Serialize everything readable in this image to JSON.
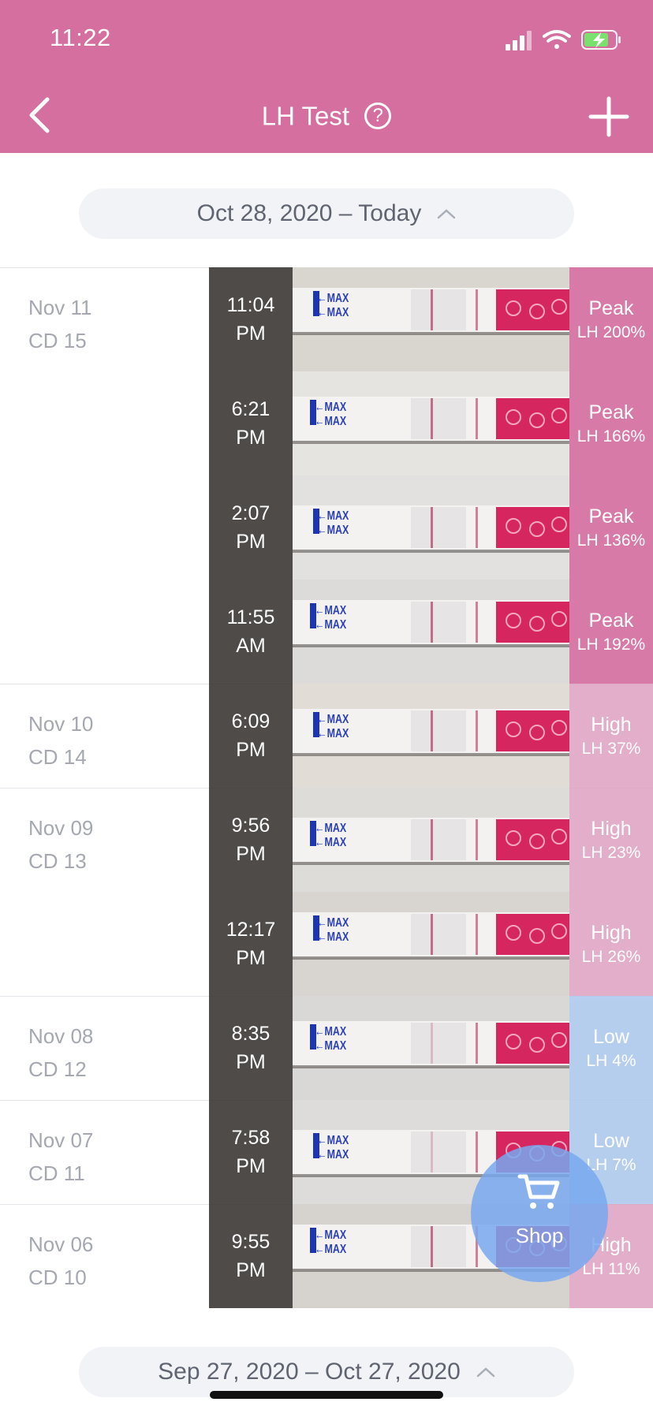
{
  "status_bar": {
    "time": "11:22"
  },
  "nav": {
    "title": "LH Test",
    "help_glyph": "?"
  },
  "ranges": {
    "current": "Oct 28, 2020 – Today",
    "previous": "Sep 27, 2020 – Oct 27, 2020"
  },
  "colors": {
    "header": "#D46FA0",
    "peak": "#D46FA0",
    "high": "#DDA0C0",
    "low": "#A9C6EC",
    "fab": "#78A8EE"
  },
  "entries": [
    {
      "date": "Nov 11",
      "cycle_day": "CD 15",
      "time": "11:04",
      "ampm": "PM",
      "level": "Peak",
      "lh": "LH 200%",
      "tone": "peak"
    },
    {
      "date": "",
      "cycle_day": "",
      "time": "6:21",
      "ampm": "PM",
      "level": "Peak",
      "lh": "LH 166%",
      "tone": "peak"
    },
    {
      "date": "",
      "cycle_day": "",
      "time": "2:07",
      "ampm": "PM",
      "level": "Peak",
      "lh": "LH 136%",
      "tone": "peak"
    },
    {
      "date": "",
      "cycle_day": "",
      "time": "11:55",
      "ampm": "AM",
      "level": "Peak",
      "lh": "LH 192%",
      "tone": "peak"
    },
    {
      "date": "Nov 10",
      "cycle_day": "CD 14",
      "time": "6:09",
      "ampm": "PM",
      "level": "High",
      "lh": "LH 37%",
      "tone": "high"
    },
    {
      "date": "Nov 09",
      "cycle_day": "CD 13",
      "time": "9:56",
      "ampm": "PM",
      "level": "High",
      "lh": "LH 23%",
      "tone": "high"
    },
    {
      "date": "",
      "cycle_day": "",
      "time": "12:17",
      "ampm": "PM",
      "level": "High",
      "lh": "LH 26%",
      "tone": "high"
    },
    {
      "date": "Nov 08",
      "cycle_day": "CD 12",
      "time": "8:35",
      "ampm": "PM",
      "level": "Low",
      "lh": "LH 4%",
      "tone": "low"
    },
    {
      "date": "Nov 07",
      "cycle_day": "CD 11",
      "time": "7:58",
      "ampm": "PM",
      "level": "Low",
      "lh": "LH 7%",
      "tone": "low"
    },
    {
      "date": "Nov 06",
      "cycle_day": "CD 10",
      "time": "9:55",
      "ampm": "PM",
      "level": "High",
      "lh": "LH 11%",
      "tone": "high"
    }
  ],
  "strip_text": "MAX",
  "shop": {
    "label": "Shop"
  }
}
